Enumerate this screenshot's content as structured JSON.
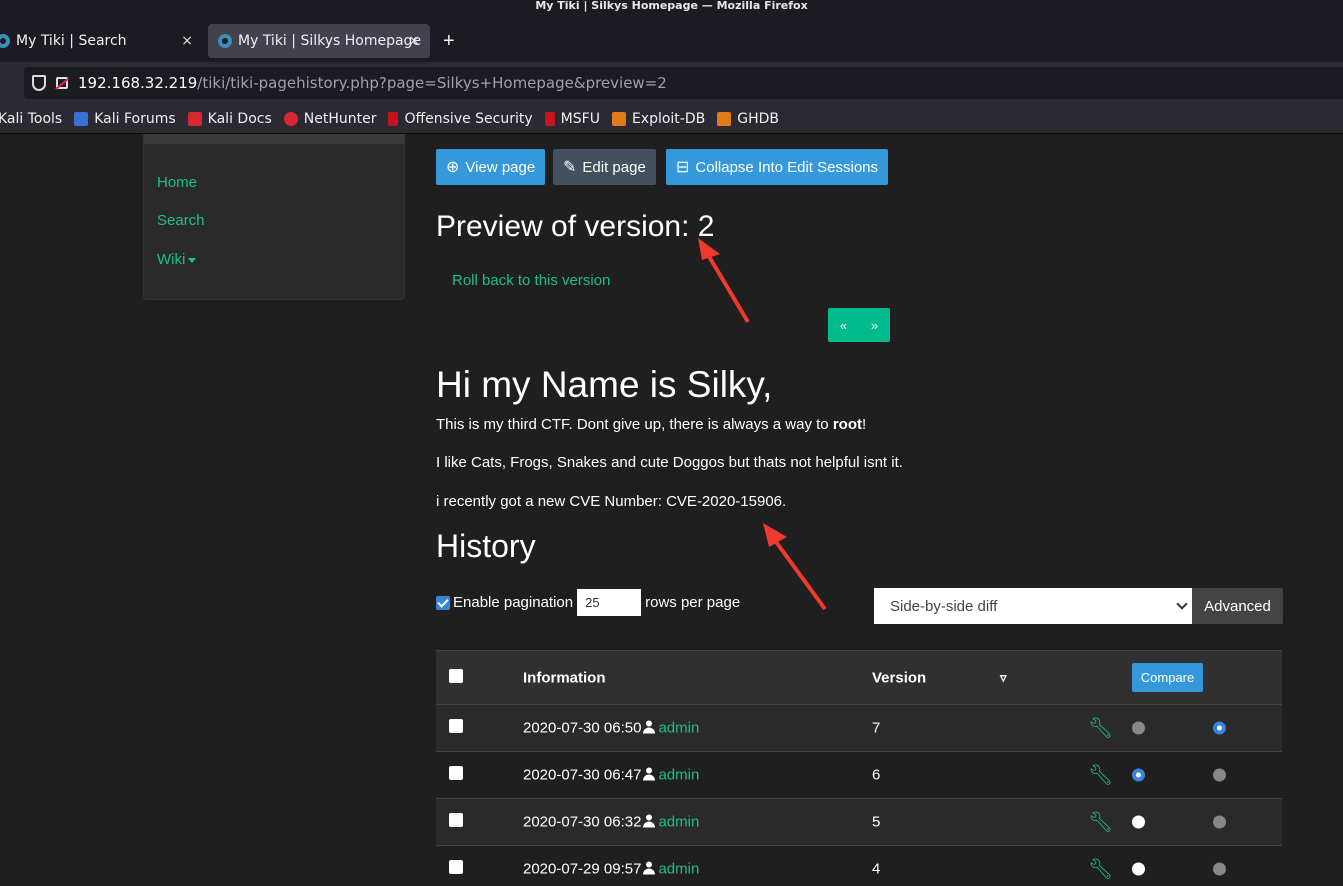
{
  "window": {
    "title": "My Tiki | Silkys Homepage — Mozilla Firefox"
  },
  "tabs": [
    {
      "label": "My Tiki | Search",
      "close": "×"
    },
    {
      "label": "My Tiki | Silkys Homepage",
      "close": "×"
    }
  ],
  "new_tab": "+",
  "url": {
    "host": "192.168.32.219",
    "path": "/tiki/tiki-pagehistory.php?page=Silkys+Homepage&preview=2"
  },
  "bookmarks": [
    "Kali Tools",
    "Kali Forums",
    "Kali Docs",
    "NetHunter",
    "Offensive Security",
    "MSFU",
    "Exploit-DB",
    "GHDB"
  ],
  "sidebar": {
    "items": [
      "Home",
      "Search",
      "Wiki"
    ]
  },
  "toolbar": {
    "view": "View page",
    "edit": "Edit page",
    "collapse": "Collapse Into Edit Sessions"
  },
  "preview_title": "Preview of version: 2",
  "rollback": "Roll back to this version",
  "pager": {
    "prev": "«",
    "next": "»"
  },
  "content": {
    "heading": "Hi my Name is Silky,",
    "p1_before": "This is my third CTF. Dont give up, there is always a way to ",
    "p1_bold": "root",
    "p1_after": "!",
    "p2": "I like Cats, Frogs, Snakes and cute Doggos but thats not helpful isnt it.",
    "p3": "i recently got a new CVE Number: CVE-2020-15906."
  },
  "history": {
    "title": "History",
    "enable_pagination": "Enable pagination",
    "rows_value": "25",
    "rows_per_page": "rows per page",
    "diff_select": "Side-by-side diff",
    "advanced": "Advanced",
    "columns": {
      "information": "Information",
      "version": "Version",
      "compare": "Compare"
    },
    "rows": [
      {
        "date": "2020-07-30 06:50",
        "user": "admin",
        "version": "7"
      },
      {
        "date": "2020-07-30 06:47",
        "user": "admin",
        "version": "6"
      },
      {
        "date": "2020-07-30 06:32",
        "user": "admin",
        "version": "5"
      },
      {
        "date": "2020-07-29 09:57",
        "user": "admin",
        "version": "4"
      }
    ]
  }
}
